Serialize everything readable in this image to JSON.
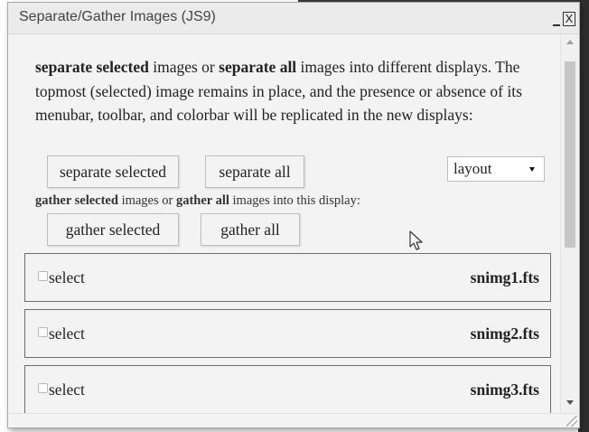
{
  "window": {
    "title": "Separate/Gather Images (JS9)",
    "minimize_label": "_",
    "close_label": "X"
  },
  "intro": {
    "part1_bold": "separate selected",
    "part2": " images or ",
    "part3_bold": "separate all",
    "part4": " images into different displays. The topmost (selected) image remains in place, and the presence or absence of its menubar, toolbar, and colorbar will be replicated in the new displays:"
  },
  "buttons": {
    "separate_selected": "separate selected",
    "separate_all": "separate all",
    "gather_selected": "gather selected",
    "gather_all": "gather all"
  },
  "layout_select": {
    "value": "layout"
  },
  "gather": {
    "part1_bold": "gather selected",
    "part2": " images or ",
    "part3_bold": "gather all",
    "part4": " images into this display:"
  },
  "images": [
    {
      "select_label": "select",
      "filename": "snimg1.fts",
      "checked": false
    },
    {
      "select_label": "select",
      "filename": "snimg2.fts",
      "checked": false
    },
    {
      "select_label": "select",
      "filename": "snimg3.fts",
      "checked": false
    }
  ],
  "icons": {
    "cursor": "mouse-pointer-icon",
    "scroll_up": "scroll-up-arrow-icon",
    "scroll_down": "scroll-down-arrow-icon",
    "resize": "resize-grip-icon"
  }
}
